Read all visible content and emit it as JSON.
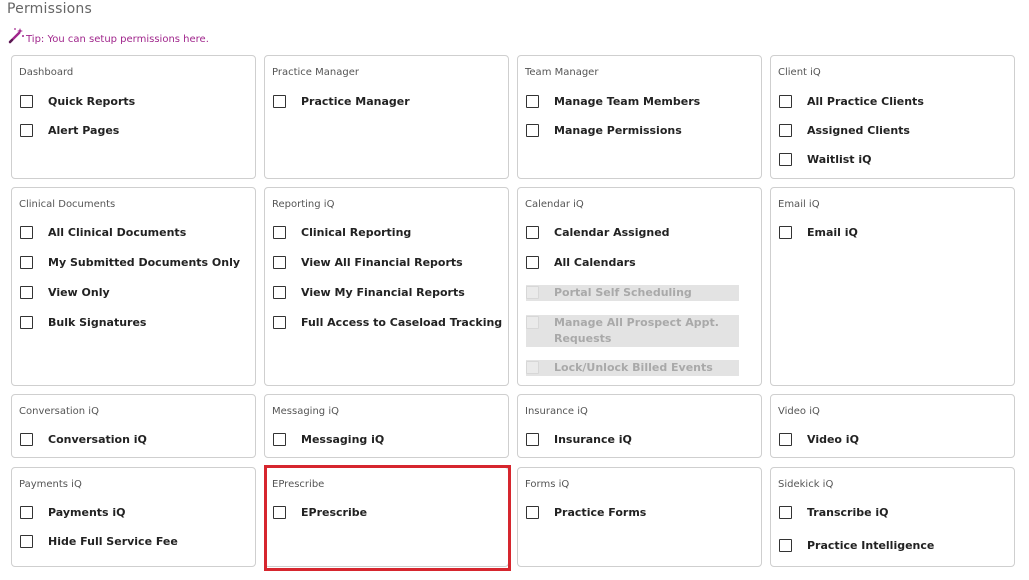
{
  "page": {
    "title": "Permissions",
    "tip": "Tip: You can setup permissions here."
  },
  "cards": [
    {
      "id": "dashboard",
      "title": "Dashboard",
      "options": [
        "Quick Reports",
        "Alert Pages"
      ]
    },
    {
      "id": "practice-manager",
      "title": "Practice Manager",
      "options": [
        "Practice Manager"
      ]
    },
    {
      "id": "team-manager",
      "title": "Team Manager",
      "options": [
        "Manage Team Members",
        "Manage Permissions"
      ]
    },
    {
      "id": "client-iq",
      "title": "Client iQ",
      "options": [
        "All Practice Clients",
        "Assigned Clients",
        "Waitlist iQ"
      ]
    },
    {
      "id": "clinical-documents",
      "title": "Clinical Documents",
      "options": [
        "All Clinical Documents",
        "My Submitted Documents Only",
        "View Only",
        "Bulk Signatures"
      ]
    },
    {
      "id": "reporting-iq",
      "title": "Reporting iQ",
      "options": [
        "Clinical Reporting",
        "View All Financial Reports",
        "View My Financial Reports",
        "Full Access to Caseload Tracking"
      ]
    },
    {
      "id": "calendar-iq",
      "title": "Calendar iQ",
      "options": [
        "Calendar Assigned",
        "All Calendars",
        "Portal Self Scheduling",
        "Manage All Prospect Appt. Requests",
        "Lock/Unlock Billed Events"
      ]
    },
    {
      "id": "email-iq",
      "title": "Email iQ",
      "options": [
        "Email iQ"
      ]
    },
    {
      "id": "conversation-iq",
      "title": "Conversation iQ",
      "options": [
        "Conversation iQ"
      ]
    },
    {
      "id": "messaging-iq",
      "title": "Messaging iQ",
      "options": [
        "Messaging iQ"
      ]
    },
    {
      "id": "insurance-iq",
      "title": "Insurance iQ",
      "options": [
        "Insurance iQ"
      ]
    },
    {
      "id": "video-iq",
      "title": "Video iQ",
      "options": [
        "Video iQ"
      ]
    },
    {
      "id": "payments-iq",
      "title": "Payments iQ",
      "options": [
        "Payments iQ",
        "Hide Full Service Fee"
      ]
    },
    {
      "id": "eprescribe",
      "title": "EPrescribe",
      "options": [
        "EPrescribe"
      ]
    },
    {
      "id": "forms-iq",
      "title": "Forms iQ",
      "options": [
        "Practice Forms"
      ]
    },
    {
      "id": "sidekick-iq",
      "title": "Sidekick iQ",
      "options": [
        "Transcribe iQ",
        "Practice Intelligence"
      ]
    }
  ],
  "disabled_options": [
    "Portal Self Scheduling",
    "Manage All Prospect Appt. Requests",
    "Lock/Unlock Billed Events"
  ],
  "checked": [],
  "highlighted_card": "EPrescribe",
  "colors": {
    "tip": "#a0268c",
    "highlight_border": "#d6262e",
    "card_border": "#cfcfcf",
    "disabled_bg": "#e3e3e3"
  },
  "icons": {
    "tip": "magic-wand-icon"
  }
}
